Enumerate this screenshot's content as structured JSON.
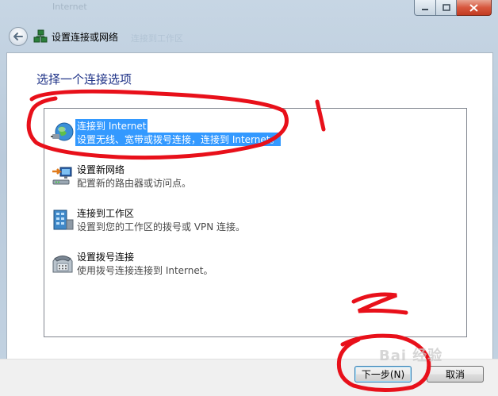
{
  "window": {
    "ghost_title": "Internet",
    "title": "设置连接或网络",
    "ghost_title2": "连接到工作区",
    "icons": {
      "back": "back-arrow-icon",
      "network": "network-setup-icon",
      "minimize": "minimize-icon",
      "maximize": "maximize-icon",
      "close": "close-icon"
    }
  },
  "main": {
    "heading": "选择一个连接选项",
    "options": [
      {
        "title": "连接到 Internet",
        "desc": "设置无线、宽带或拨号连接，连接到 Internet。",
        "icon": "globe-icon",
        "selected": true
      },
      {
        "title": "设置新网络",
        "desc": "配置新的路由器或访问点。",
        "icon": "router-icon",
        "selected": false
      },
      {
        "title": "连接到工作区",
        "desc": "设置到您的工作区的拨号或 VPN 连接。",
        "icon": "workplace-icon",
        "selected": false
      },
      {
        "title": "设置拨号连接",
        "desc": "使用拨号连接连接到 Internet。",
        "icon": "phone-icon",
        "selected": false
      }
    ]
  },
  "footer": {
    "next_label": "下一步(N)",
    "cancel_label": "取消"
  },
  "annotations": {
    "label1": "1",
    "label2": "2",
    "color": "#e8101a"
  },
  "watermark": "Bai 经验"
}
